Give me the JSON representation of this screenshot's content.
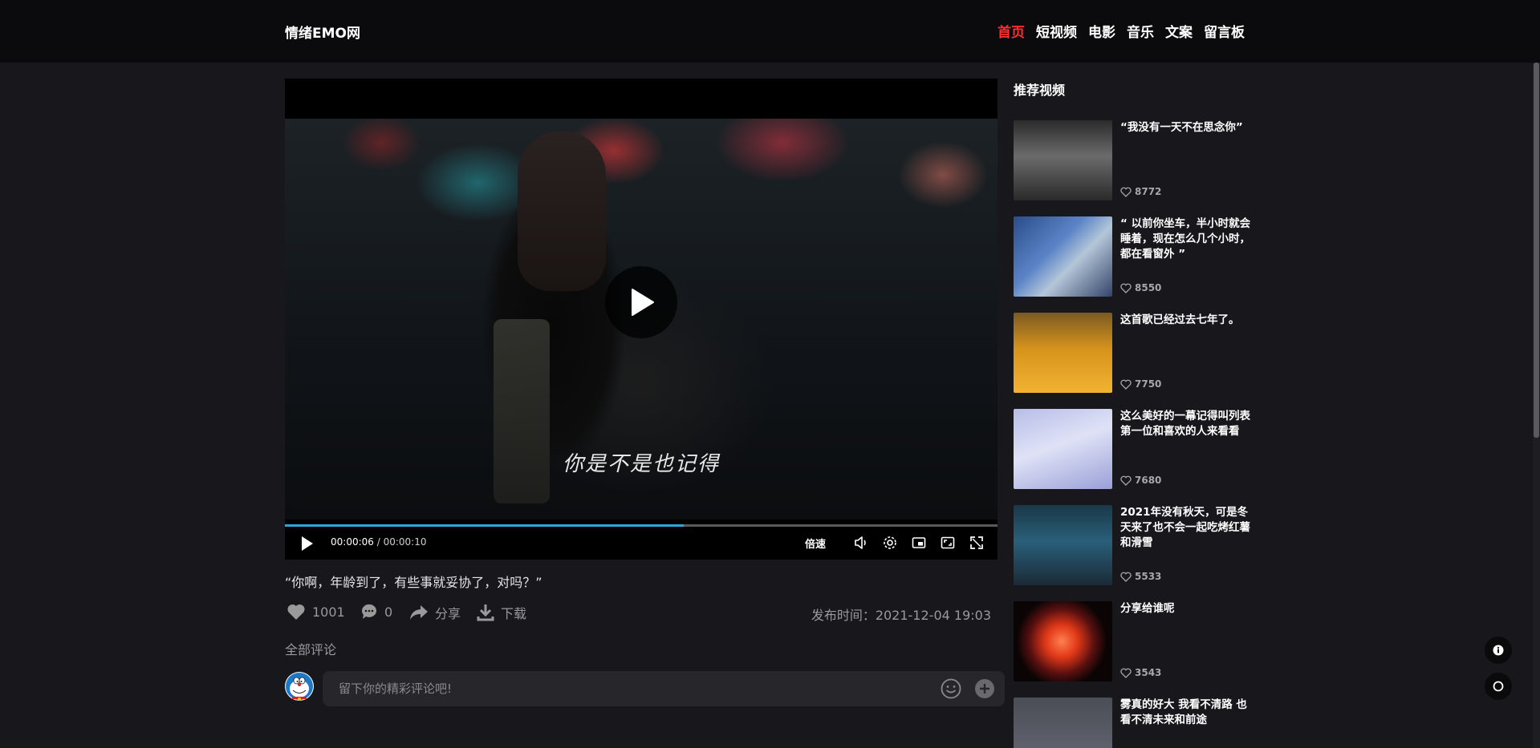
{
  "header": {
    "logo": "情绪EMO网",
    "nav": [
      {
        "label": "首页",
        "active": true
      },
      {
        "label": "短视频",
        "active": false
      },
      {
        "label": "电影",
        "active": false
      },
      {
        "label": "音乐",
        "active": false
      },
      {
        "label": "文案",
        "active": false
      },
      {
        "label": "留言板",
        "active": false
      }
    ]
  },
  "player": {
    "subtitle": "你是不是也记得",
    "current_time": "00:00:06",
    "duration": "00:00:10",
    "progress": 0.56,
    "speed_label": "倍速"
  },
  "video": {
    "title": "“你啊，年龄到了，有些事就妥协了，对吗？”",
    "likes": "1001",
    "comments": "0",
    "share_label": "分享",
    "download_label": "下载",
    "publish_time": "发布时间：2021-12-04 19:03"
  },
  "comments": {
    "header": "全部评论",
    "placeholder": "留下你的精彩评论吧!"
  },
  "sidebar": {
    "title": "推荐视频",
    "items": [
      {
        "title": "“我没有一天不在思念你”",
        "likes": "8772"
      },
      {
        "title": "“ 以前你坐车，半小时就会睡着，现在怎么几个小时，都在看窗外 ”",
        "likes": "8550"
      },
      {
        "title": "这首歌已经过去七年了。",
        "likes": "7750"
      },
      {
        "title": "这么美好的一幕记得叫列表第一位和喜欢的人来看看",
        "likes": "7680"
      },
      {
        "title": "2021年没有秋天，可是冬天来了也不会一起吃烤红薯和滑雪",
        "likes": "5533"
      },
      {
        "title": "分享给谁呢",
        "likes": "3543"
      },
      {
        "title": "雾真的好大 我看不清路 也看不清未来和前途",
        "likes": ""
      }
    ]
  },
  "colors": {
    "accent_nav": "#ff2d2d",
    "progress": "#2aa8d8",
    "background": "#17171c"
  }
}
